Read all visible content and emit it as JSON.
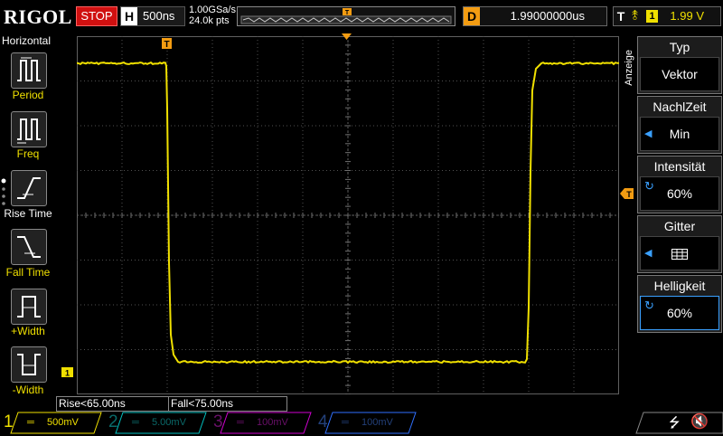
{
  "top": {
    "logo": "RIGOL",
    "run_state": "STOP",
    "h_label": "H",
    "timebase": "500ns",
    "sample_rate": "1.00GSa/s",
    "mem_depth": "24.0k pts",
    "d_label": "D",
    "delay": "1.99000000us",
    "t_label": "T",
    "trig_ch": "1",
    "trig_level": "1.99 V"
  },
  "left_panel": {
    "title": "Horizontal",
    "items": [
      {
        "label": "Period"
      },
      {
        "label": "Freq"
      },
      {
        "label": "Rise Time"
      },
      {
        "label": "Fall Time"
      },
      {
        "label": "+Width"
      },
      {
        "label": "-Width"
      }
    ]
  },
  "right_menu": {
    "side_label": "Anzeige",
    "items": [
      {
        "title": "Typ",
        "value": "Vektor"
      },
      {
        "title": "NachlZeit",
        "value": "Min"
      },
      {
        "title": "Intensität",
        "value": "60%"
      },
      {
        "title": "Gitter",
        "value": ""
      },
      {
        "title": "Helligkeit",
        "value": "60%"
      }
    ]
  },
  "measurements": {
    "rise": "Rise<65.00ns",
    "fall": "Fall<75.00ns"
  },
  "channels": [
    {
      "num": "1",
      "scale": "500mV",
      "color": "#f0e000"
    },
    {
      "num": "2",
      "scale": "5.00mV",
      "color": "#00c0c0"
    },
    {
      "num": "3",
      "scale": "100mV",
      "color": "#d000d0"
    },
    {
      "num": "4",
      "scale": "100mV",
      "color": "#3070ff"
    }
  ],
  "markers": {
    "ch1_ground": "1",
    "trigger_pos": "T"
  }
}
